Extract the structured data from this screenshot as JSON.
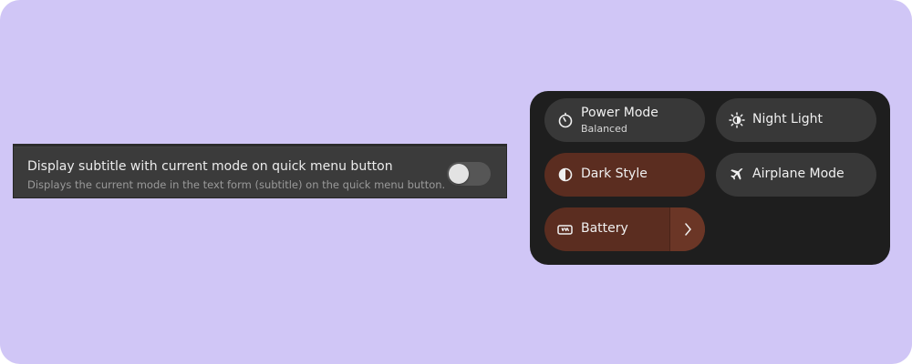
{
  "preference": {
    "title": "Display subtitle with current mode on quick menu button",
    "subtitle": "Displays the current mode in the text form (subtitle) on the quick menu button.",
    "switch_on": false
  },
  "quick_settings": {
    "tiles": [
      {
        "label": "Power Mode",
        "subtitle": "Balanced",
        "icon": "power-mode-icon",
        "active": false
      },
      {
        "label": "Night Light",
        "icon": "night-light-icon",
        "active": false
      },
      {
        "label": "Dark Style",
        "icon": "dark-style-icon",
        "active": true
      },
      {
        "label": "Airplane Mode",
        "icon": "airplane-icon",
        "active": false
      },
      {
        "label": "Battery",
        "icon": "battery-icon",
        "active": true,
        "has_menu_arrow": true
      }
    ]
  },
  "colors": {
    "background": "#d0c6f6",
    "panel": "#1e1e1e",
    "tile": "#383838",
    "tile_active": "#5b2d20"
  }
}
